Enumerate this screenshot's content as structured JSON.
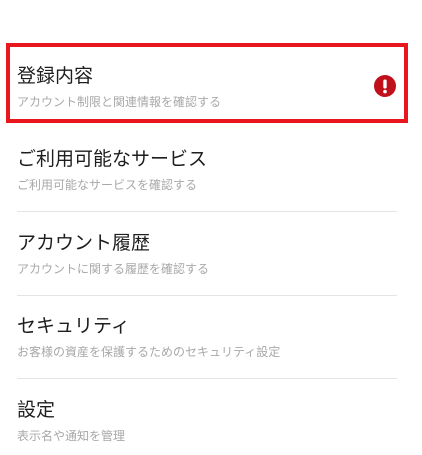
{
  "menu": {
    "items": [
      {
        "title": "登録内容",
        "subtitle": "アカウント制限と関連情報を確認する",
        "alert": true
      },
      {
        "title": "ご利用可能なサービス",
        "subtitle": "ご利用可能なサービスを確認する"
      },
      {
        "title": "アカウント履歴",
        "subtitle": "アカウントに関する履歴を確認する"
      },
      {
        "title": "セキュリティ",
        "subtitle": "お客様の資産を保護するためのセキュリティ設定"
      },
      {
        "title": "設定",
        "subtitle": "表示名や通知を管理"
      }
    ]
  },
  "colors": {
    "highlight_border": "#e8171d",
    "alert_icon": "#c0101b",
    "title_text": "#1e1e1e",
    "subtitle_text": "#a8a8a8",
    "divider": "#e4e4e4"
  },
  "icons": {
    "alert": "exclamation-circle-icon"
  }
}
